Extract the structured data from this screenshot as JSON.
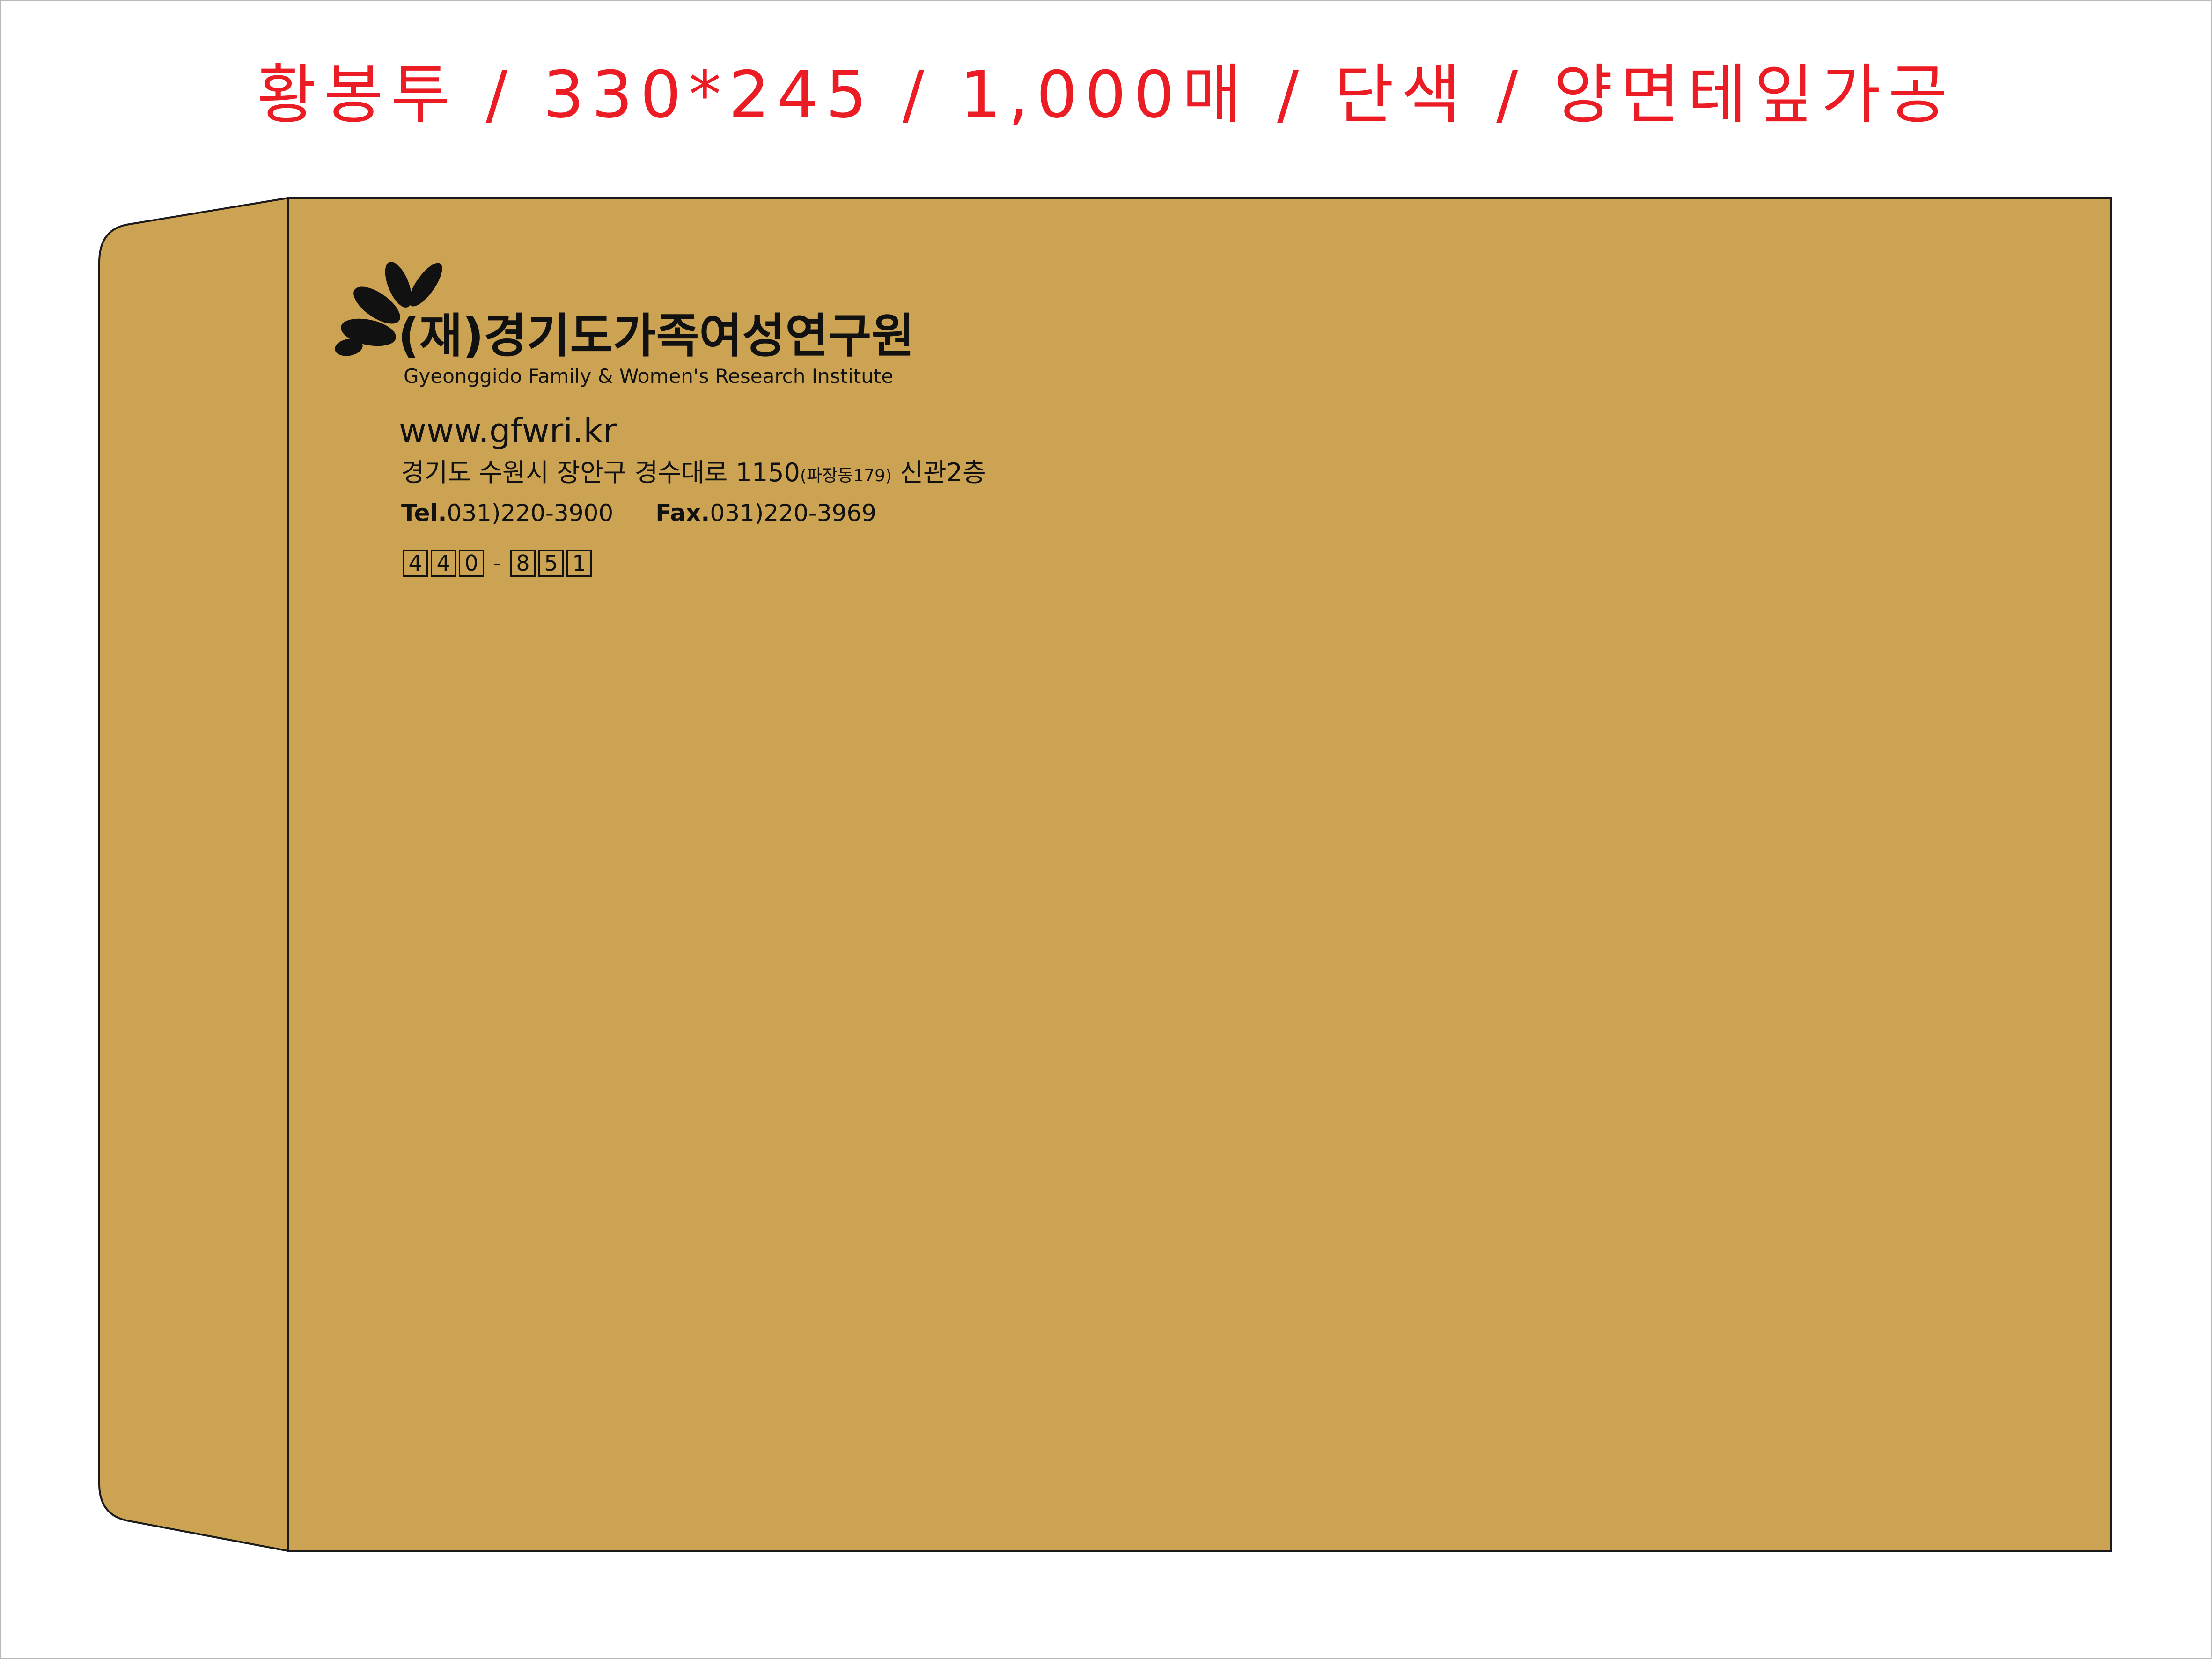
{
  "spec_title": "황봉투 / 330*245 / 1,000매 / 단색 / 양면테잎가공",
  "colors": {
    "title_red": "#ec1c24",
    "envelope_kraft": "#cba353",
    "envelope_outline": "#1a1a1a",
    "ink": "#111111"
  },
  "logo": {
    "icon": "petal-logo-icon"
  },
  "envelope": {
    "org_name_ko": "(재)경기도가족여성연구원",
    "org_name_en": "Gyeonggido Family & Women's Research Institute",
    "website": "www.gfwri.kr",
    "address": {
      "main": "경기도 수원시 장안구 경수대로 1150",
      "sub": "(파장동179)",
      "floor": " 신관2층"
    },
    "tel": {
      "label": "Tel.",
      "number": "031)220-3900"
    },
    "fax": {
      "label": "Fax.",
      "number": "031)220-3969"
    },
    "postal_code": {
      "first": [
        "4",
        "4",
        "0"
      ],
      "separator": "-",
      "second": [
        "8",
        "5",
        "1"
      ]
    }
  }
}
